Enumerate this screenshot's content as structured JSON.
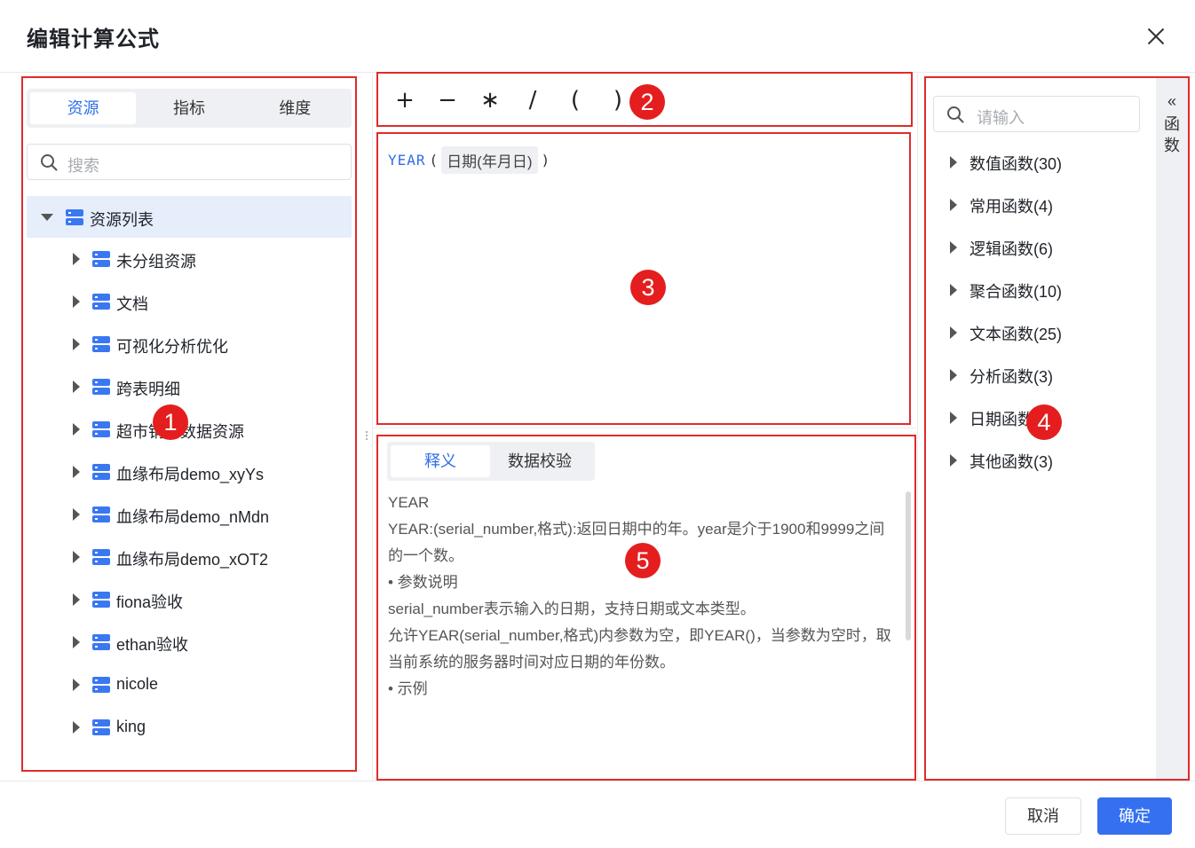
{
  "dialog": {
    "title": "编辑计算公式"
  },
  "left": {
    "tabs": [
      "资源",
      "指标",
      "维度"
    ],
    "search_placeholder": "搜索",
    "tree_root": "资源列表",
    "items": [
      "未分组资源",
      "文档",
      "可视化分析优化",
      "跨表明细",
      "超市销售数据资源",
      "血缘布局demo_xyYs",
      "血缘布局demo_nMdn",
      "血缘布局demo_xOT2",
      "fiona验收",
      "ethan验收",
      "nicole",
      "king"
    ]
  },
  "operators": [
    "+",
    "−",
    "∗",
    "/",
    "(",
    ")"
  ],
  "editor": {
    "function": "YEAR",
    "open_paren": "(",
    "argument": "日期(年月日)",
    "close_paren": ")"
  },
  "description": {
    "tabs": [
      "释义",
      "数据校验"
    ],
    "lines": [
      "YEAR",
      "YEAR:(serial_number,格式):返回日期中的年。year是介于1900和9999之间的一个数。",
      "• 参数说明",
      "serial_number表示输入的日期，支持日期或文本类型。",
      "允许YEAR(serial_number,格式)内参数为空，即YEAR()，当参数为空时，取当前系统的服务器时间对应日期的年份数。",
      "• 示例"
    ]
  },
  "functions": {
    "search_placeholder": "请输入",
    "categories": [
      "数值函数(30)",
      "常用函数(4)",
      "逻辑函数(6)",
      "聚合函数(10)",
      "文本函数(25)",
      "分析函数(3)",
      "日期函数(",
      "其他函数(3)"
    ],
    "side_label_chevron": "«",
    "side_label": [
      "函",
      "数"
    ]
  },
  "annotations": [
    "1",
    "2",
    "3",
    "4",
    "5"
  ],
  "footer": {
    "cancel": "取消",
    "ok": "确定"
  },
  "colors": {
    "accent": "#3470f0",
    "annotation_red": "#e02b2b"
  }
}
